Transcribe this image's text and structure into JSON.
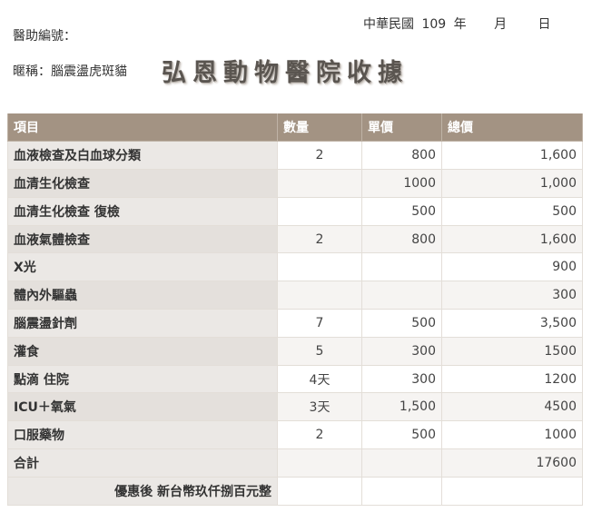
{
  "header": {
    "date": {
      "era": "中華民國",
      "year": "109",
      "year_unit": "年",
      "month_unit": "月",
      "day_unit": "日"
    },
    "medical_id_label": "醫助編號：",
    "pet_label": "暱稱：腦震盪虎斑貓",
    "title": "弘恩動物醫院收據"
  },
  "table": {
    "columns": [
      "項目",
      "數量",
      "單價",
      "總價"
    ],
    "rows": [
      {
        "item": "血液檢查及白血球分類",
        "qty": "2",
        "price": "800",
        "total": "1,600"
      },
      {
        "item": "血清生化檢查",
        "qty": "",
        "price": "1000",
        "total": "1,000"
      },
      {
        "item": "血清生化檢查 復檢",
        "qty": "",
        "price": "500",
        "total": "500"
      },
      {
        "item": "血液氣體檢查",
        "qty": "2",
        "price": "800",
        "total": "1,600"
      },
      {
        "item": "X光",
        "qty": "",
        "price": "",
        "total": "900"
      },
      {
        "item": "體內外驅蟲",
        "qty": "",
        "price": "",
        "total": "300"
      },
      {
        "item": "腦震盪針劑",
        "qty": "7",
        "price": "500",
        "total": "3,500"
      },
      {
        "item": "灌食",
        "qty": "5",
        "price": "300",
        "total": "1500"
      },
      {
        "item": "點滴 住院",
        "qty": "4天",
        "price": "300",
        "total": "1200"
      },
      {
        "item": "ICU＋氧氣",
        "qty": "3天",
        "price": "1,500",
        "total": "4500"
      },
      {
        "item": "口服藥物",
        "qty": "2",
        "price": "500",
        "total": "1000"
      }
    ],
    "total": {
      "label": "合計",
      "value": "17600"
    },
    "discount": {
      "label": "優惠後 新台幣玖仟捌百元整",
      "value": ""
    }
  },
  "colors": {
    "header_bg": "#a39383",
    "item_bg": "#ebe8e5",
    "title_color": "#5a5550"
  }
}
